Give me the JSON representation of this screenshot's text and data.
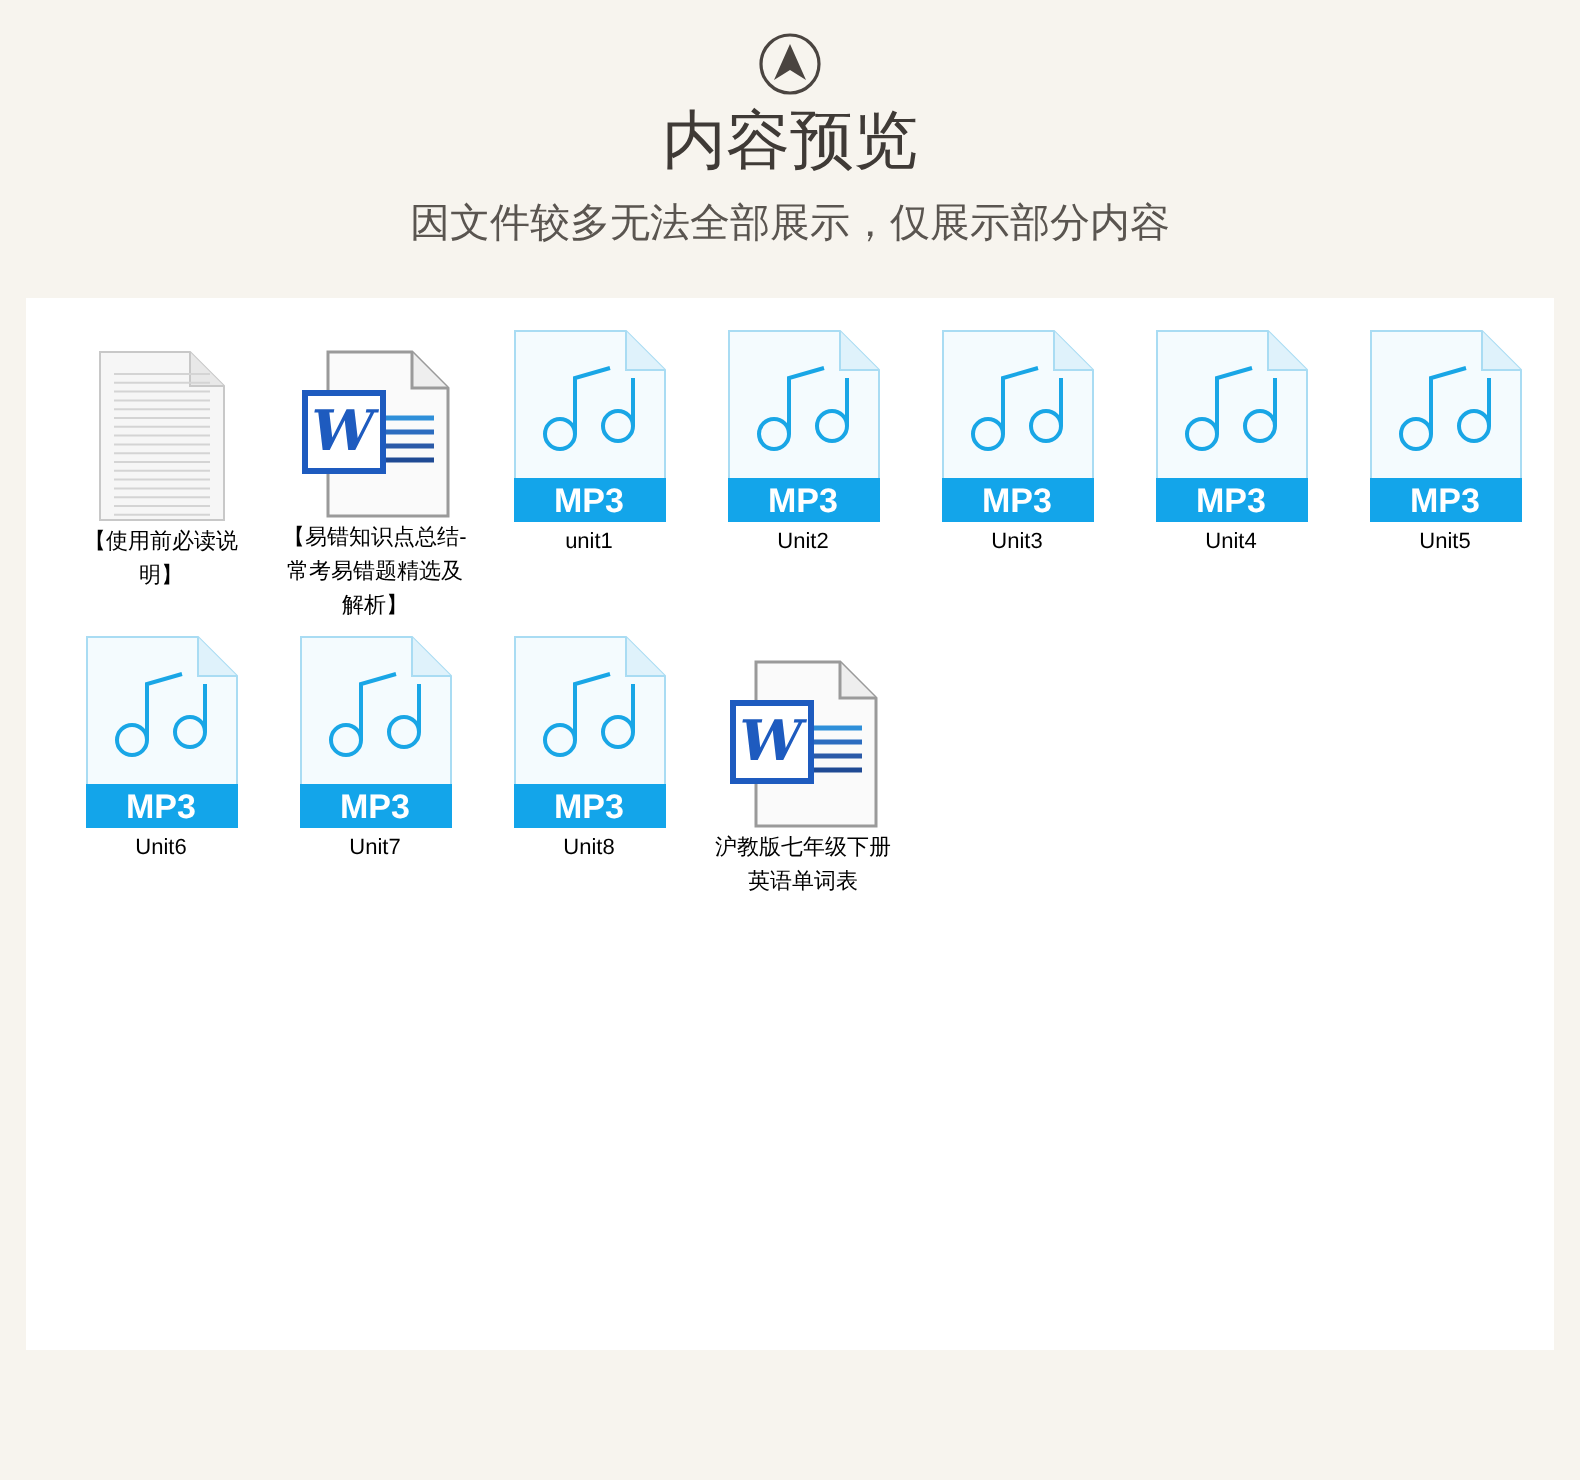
{
  "header": {
    "title": "内容预览",
    "subtitle": "因文件较多无法全部展示，仅展示部分内容"
  },
  "files": [
    {
      "kind": "text",
      "name": "【使用前必读说明】"
    },
    {
      "kind": "word",
      "name": "【易错知识点总结-常考易错题精选及解析】",
      "badge": "W"
    },
    {
      "kind": "mp3",
      "name": "unit1",
      "badge": "MP3"
    },
    {
      "kind": "mp3",
      "name": "Unit2",
      "badge": "MP3"
    },
    {
      "kind": "mp3",
      "name": "Unit3",
      "badge": "MP3"
    },
    {
      "kind": "mp3",
      "name": "Unit4",
      "badge": "MP3"
    },
    {
      "kind": "mp3",
      "name": "Unit5",
      "badge": "MP3"
    },
    {
      "kind": "mp3",
      "name": "Unit6",
      "badge": "MP3"
    },
    {
      "kind": "mp3",
      "name": "Unit7",
      "badge": "MP3"
    },
    {
      "kind": "mp3",
      "name": "Unit8",
      "badge": "MP3"
    },
    {
      "kind": "word",
      "name": "沪教版七年级下册英语单词表",
      "badge": "W"
    }
  ]
}
